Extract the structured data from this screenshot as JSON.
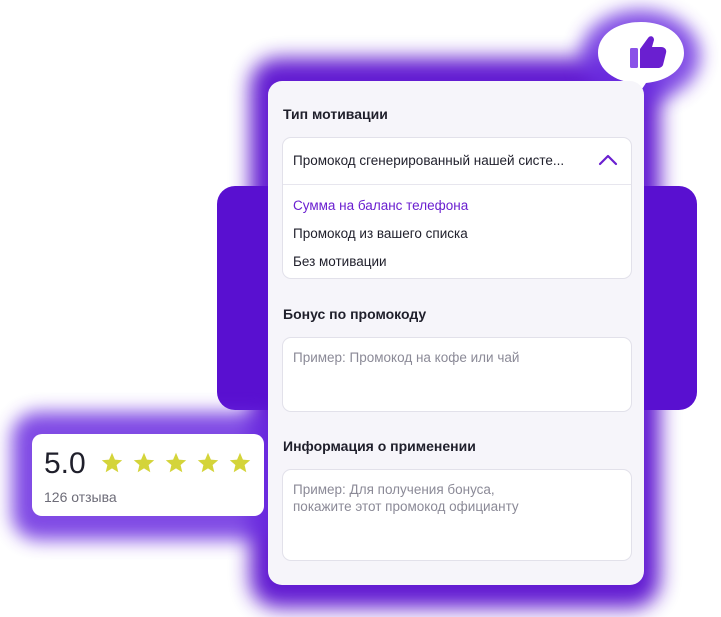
{
  "form": {
    "motivation_label": "Тип мотивации",
    "motivation_selected": "Промокод сгенерированный нашей систе...",
    "motivation_options": [
      "Сумма на баланс телефона",
      "Промокод из вашего списка",
      "Без мотивации"
    ],
    "bonus_label": "Бонус по промокоду",
    "bonus_placeholder": "Пример: Промокод на кофе или чай",
    "info_label": "Информация о применении",
    "info_placeholder": "Пример: Для получения бонуса,\nпокажите этот промокод официанту"
  },
  "rating": {
    "score": "5.0",
    "stars": 5,
    "reviews": "126 отзыва"
  },
  "colors": {
    "accent": "#6a1fd0",
    "glow": "#5a0fcf",
    "star": "#d4d43a",
    "text": "#1f1f2b",
    "placeholder": "#8b8a97"
  },
  "icons": {
    "dropdown": "chevron-up-icon",
    "star": "star-icon",
    "bubble": "thumbs-up-icon"
  }
}
